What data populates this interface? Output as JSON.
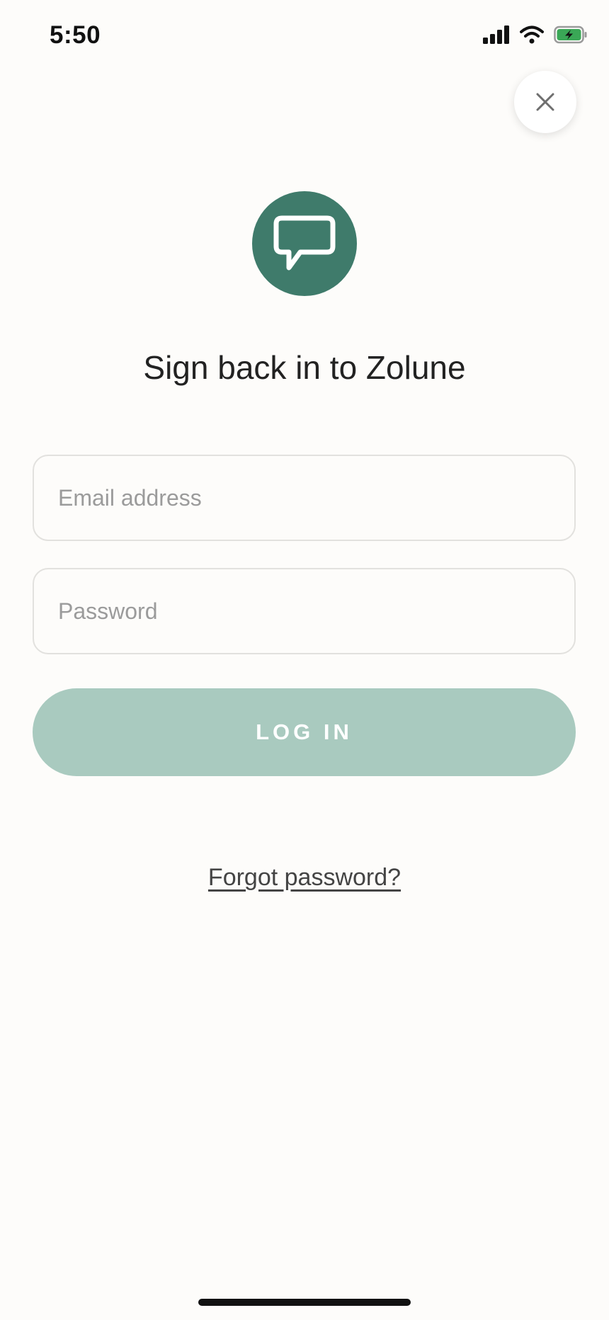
{
  "status_bar": {
    "time": "5:50",
    "icons": [
      "cellular-signal-icon",
      "wifi-icon",
      "battery-charging-icon"
    ],
    "battery_color": "#3aa756"
  },
  "header": {
    "close_icon": "close-icon"
  },
  "brand": {
    "logo_icon": "chat-bubble-icon",
    "logo_color": "#3f7b6b",
    "title": "Sign back in to Zolune"
  },
  "form": {
    "email_placeholder": "Email address",
    "email_value": "",
    "password_placeholder": "Password",
    "password_value": "",
    "login_label": "LOG IN",
    "login_color": "#a9cabf",
    "forgot_label": "Forgot password?"
  }
}
